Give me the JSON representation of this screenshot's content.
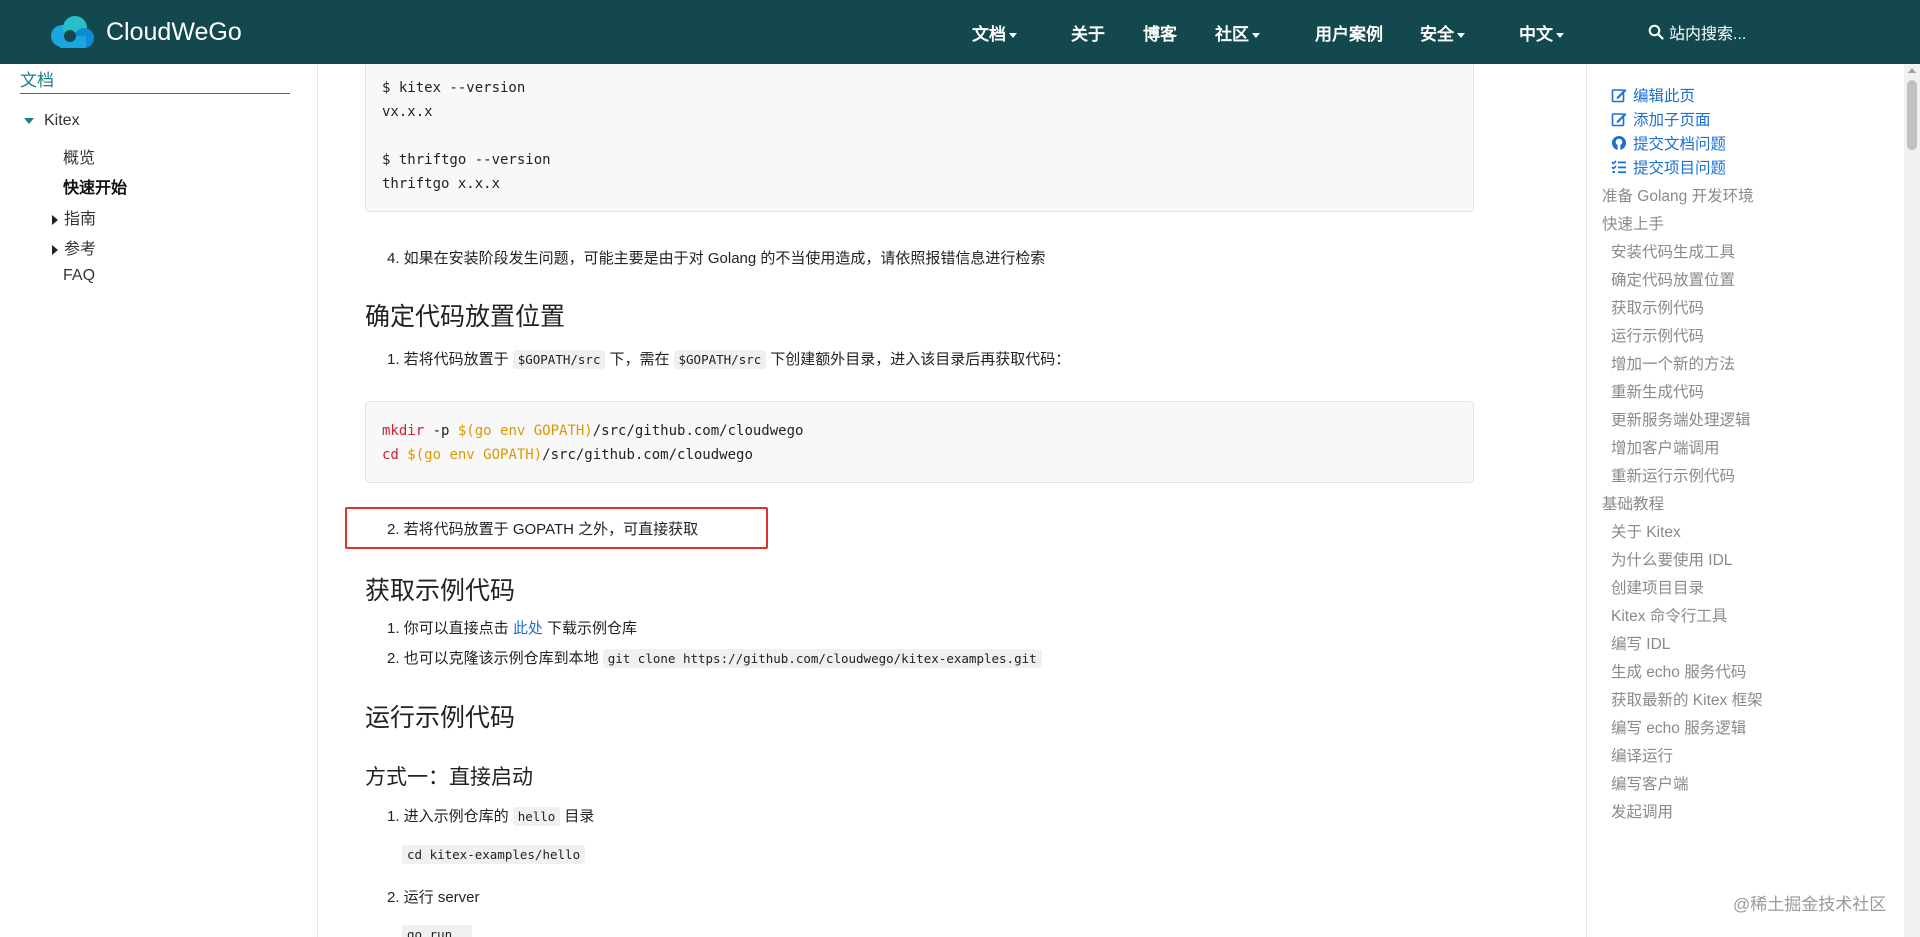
{
  "navbar": {
    "brand": "CloudWeGo",
    "items": [
      {
        "label": "文档",
        "dropdown": true
      },
      {
        "label": "关于",
        "dropdown": false
      },
      {
        "label": "博客",
        "dropdown": false
      },
      {
        "label": "社区",
        "dropdown": true
      },
      {
        "label": "用户案例",
        "dropdown": false
      },
      {
        "label": "安全",
        "dropdown": true
      },
      {
        "label": "中文",
        "dropdown": true
      }
    ],
    "search_placeholder": "站内搜索..."
  },
  "sidebar": {
    "title": "文档",
    "section": "Kitex",
    "items": [
      "概览",
      "快速开始",
      "指南",
      "参考",
      "FAQ"
    ],
    "active": "快速开始"
  },
  "main": {
    "code1": [
      "$ kitex --version",
      "vx.x.x",
      "",
      "$ thriftgo --version",
      "thriftgo x.x.x"
    ],
    "step4": "4. 如果在安装阶段发生问题，可能主要是由于对 Golang 的不当使用造成，请依照报错信息进行检索",
    "h_location": "确定代码放置位置",
    "loc1_a": "1. 若将代码放置于",
    "loc1_code1": "$GOPATH/src",
    "loc1_b": "下，需在",
    "loc1_code2": "$GOPATH/src",
    "loc1_c": "下创建额外目录，进入该目录后再获取代码：",
    "code2": {
      "line1": {
        "cmd": "mkdir",
        "rest1": " -p ",
        "var": "$(go env GOPATH)",
        "rest2": "/src/github.com/cloudwego"
      },
      "line2": {
        "cmd": "cd",
        "rest1": " ",
        "var": "$(go env GOPATH)",
        "rest2": "/src/github.com/cloudwego"
      }
    },
    "loc2": "2. 若将代码放置于 GOPATH 之外，可直接获取",
    "h_get": "获取示例代码",
    "get1_a": "1. 你可以直接点击",
    "get1_link": "此处",
    "get1_b": "下载示例仓库",
    "get2_a": "2. 也可以克隆该示例仓库到本地",
    "get2_code": "git clone https://github.com/cloudwego/kitex-examples.git",
    "h_run": "运行示例代码",
    "h_way1": "方式一：直接启动",
    "run1_a": "1. 进入示例仓库的",
    "run1_code": "hello",
    "run1_b": "目录",
    "run1_cmd": "cd kitex-examples/hello",
    "run2": "2. 运行 server",
    "run2_cmd": "go run ."
  },
  "toc": {
    "actions": [
      "编辑此页",
      "添加子页面",
      "提交文档问题",
      "提交项目问题"
    ],
    "items": [
      {
        "label": "准备 Golang 开发环境",
        "level": 1
      },
      {
        "label": "快速上手",
        "level": 1
      },
      {
        "label": "安装代码生成工具",
        "level": 2
      },
      {
        "label": "确定代码放置位置",
        "level": 2
      },
      {
        "label": "获取示例代码",
        "level": 2
      },
      {
        "label": "运行示例代码",
        "level": 2
      },
      {
        "label": "增加一个新的方法",
        "level": 2
      },
      {
        "label": "重新生成代码",
        "level": 2
      },
      {
        "label": "更新服务端处理逻辑",
        "level": 2
      },
      {
        "label": "增加客户端调用",
        "level": 2
      },
      {
        "label": "重新运行示例代码",
        "level": 2
      },
      {
        "label": "基础教程",
        "level": 1
      },
      {
        "label": "关于 Kitex",
        "level": 2
      },
      {
        "label": "为什么要使用 IDL",
        "level": 2
      },
      {
        "label": "创建项目目录",
        "level": 2
      },
      {
        "label": "Kitex 命令行工具",
        "level": 2
      },
      {
        "label": "编写 IDL",
        "level": 2
      },
      {
        "label": "生成 echo 服务代码",
        "level": 2
      },
      {
        "label": "获取最新的 Kitex 框架",
        "level": 2
      },
      {
        "label": "编写 echo 服务逻辑",
        "level": 2
      },
      {
        "label": "编译运行",
        "level": 2
      },
      {
        "label": "编写客户端",
        "level": 2
      },
      {
        "label": "发起调用",
        "level": 2
      }
    ]
  },
  "watermark": "@稀土掘金技术社区",
  "colors": {
    "navbar": "#14484f",
    "link": "#1a6fd1",
    "highlight": "#e03030",
    "accent": "#1b7f8a"
  }
}
